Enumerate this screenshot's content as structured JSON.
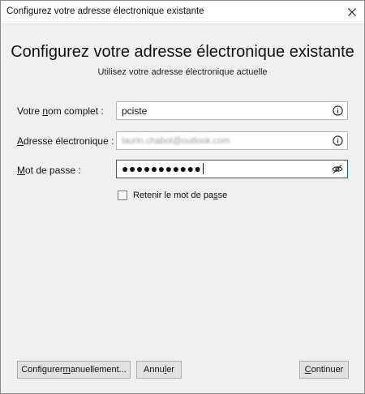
{
  "window": {
    "title": "Configurez votre adresse électronique existante"
  },
  "header": {
    "title": "Configurez votre adresse électronique existante",
    "subtitle": "Utilisez votre adresse électronique actuelle"
  },
  "form": {
    "name": {
      "label_pre": "Votre ",
      "label_key": "n",
      "label_post": "om complet :",
      "value": "pciste",
      "icon": "info-icon"
    },
    "email": {
      "label_pre": "",
      "label_key": "A",
      "label_post": "dresse électronique :",
      "value": "laurin.chabot@outlook.com",
      "icon": "info-icon"
    },
    "password": {
      "label_pre": "",
      "label_key": "M",
      "label_post": "ot de passe :",
      "value": "●●●●●●●●●●●",
      "icon": "eye-slash-icon"
    },
    "remember": {
      "label_pre": "Retenir le mot de pa",
      "label_key": "s",
      "label_post": "se",
      "checked": false
    }
  },
  "buttons": {
    "manual": {
      "pre": "Configurer ",
      "key": "m",
      "post": "anuellement..."
    },
    "cancel": {
      "pre": "Annu",
      "key": "l",
      "post": "er"
    },
    "continue": {
      "pre": "",
      "key": "C",
      "post": "ontinuer"
    }
  },
  "colors": {
    "focus_border": "#0a62b7",
    "field_border": "#b7b7b7",
    "background": "#f0f0f0"
  }
}
